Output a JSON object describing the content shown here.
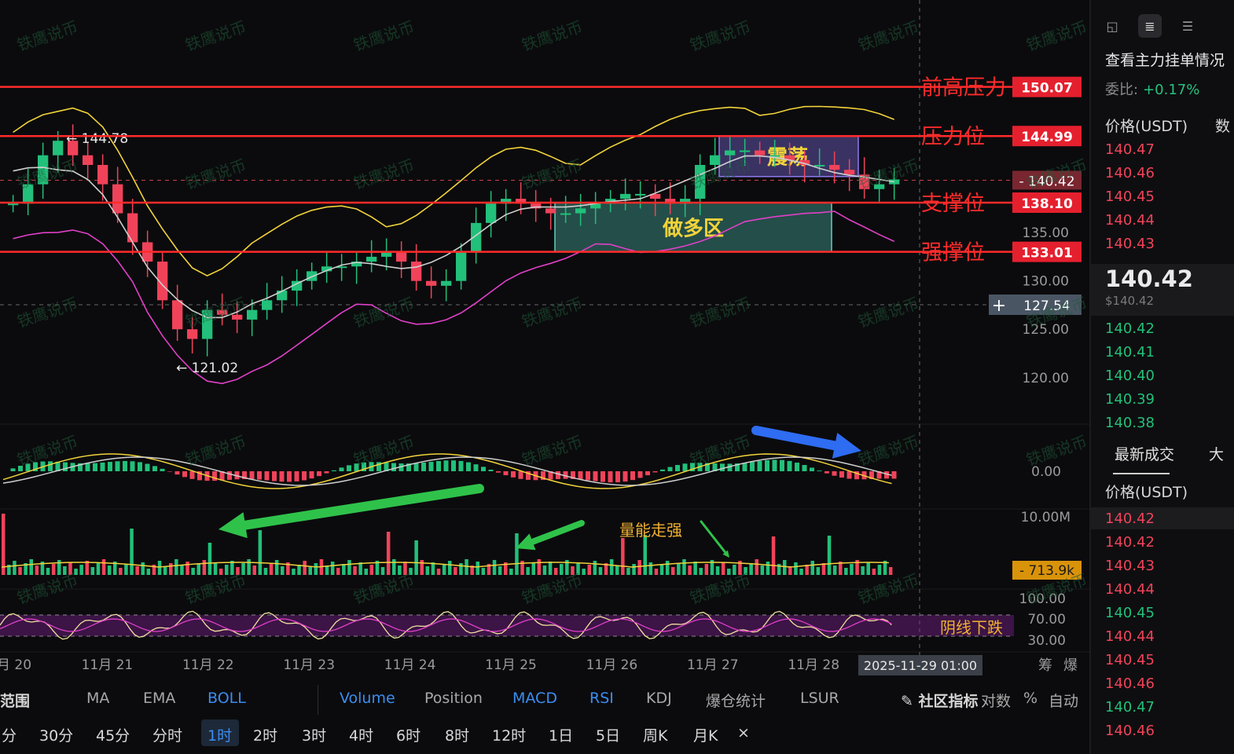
{
  "colors": {
    "up": "#22c07a",
    "down": "#f0435a",
    "boll_upper": "#f2d33a",
    "boll_mid": "#cfcfcf",
    "boll_lower": "#e040c8",
    "level_line": "#ff2b2b",
    "box_long": "#5fd0c0",
    "box_range": "#8f7bf0",
    "arrow_green": "#2fc24a",
    "arrow_blue": "#2e6cf2",
    "watermark": "#1f5a3a"
  },
  "watermark_text": "铁鹰说币",
  "chart_data": {
    "type": "candlestick",
    "timeframe": "1时",
    "x_ticks": [
      "月 20",
      "11月 21",
      "11月 22",
      "11月 23",
      "11月 24",
      "11月 25",
      "11月 26",
      "11月 27",
      "11月 28"
    ],
    "crosshair_time": "2025-11-29 01:00",
    "y_ticks": [
      "135.00",
      "130.00",
      "125.00",
      "120.00"
    ],
    "ylim": [
      116,
      155
    ],
    "price_extremes": [
      {
        "label": "← 144.78",
        "value": 144.78
      },
      {
        "label": "← 121.02",
        "value": 121.02
      }
    ],
    "close_series": [
      138,
      140,
      143,
      144.5,
      143,
      142,
      140,
      137,
      134,
      132,
      128,
      125,
      124,
      127,
      126.5,
      126,
      127,
      128,
      129,
      130,
      131,
      131.5,
      131.5,
      132,
      132.5,
      133,
      132,
      130,
      129.5,
      130,
      133,
      136,
      138,
      138.5,
      138,
      137.5,
      137,
      137,
      137.5,
      138,
      138.5,
      139,
      139,
      138.5,
      138,
      138.5,
      142,
      143,
      143.5,
      143.5,
      143,
      143,
      142.5,
      142,
      142,
      141.5,
      141,
      139.5,
      140,
      140.5
    ],
    "levels": [
      {
        "label": "前高压力",
        "value": 150.07,
        "price": "150.07"
      },
      {
        "label": "压力位",
        "value": 144.99,
        "price": "144.99"
      },
      {
        "label": "支撑位",
        "value": 138.1,
        "price": "138.10"
      },
      {
        "label": "强撑位",
        "value": 133.01,
        "price": "133.01"
      }
    ],
    "current_price": {
      "value": 140.42,
      "label": "140.42"
    },
    "crosshair_price": {
      "value": 127.54,
      "label": "127.54"
    },
    "zones": [
      {
        "label": "做多区",
        "x_start": "11月 25",
        "x_end": "11月 27",
        "y_top": 138.1,
        "y_bottom": 133.01
      },
      {
        "label": "震荡",
        "x_start": "11月 27",
        "x_end": "11月 28",
        "y_top": 144.99,
        "y_bottom": 140.8
      }
    ],
    "macd": {
      "axis_label": "0.00"
    },
    "volume": {
      "axis_label": "10.00M",
      "current": "713.9k",
      "annotation": "量能走强"
    },
    "rsi": {
      "ticks": [
        "100.00",
        "70.00",
        "30.00"
      ],
      "annotation": "阴线下跌"
    }
  },
  "right_axis_footer": [
    "筹",
    "爆"
  ],
  "side_panel": {
    "title": "查看主力挂单情况",
    "ratio_label": "委比:",
    "ratio_value": "+0.17%",
    "col_head": "价格(USDT)",
    "col_head2": "数",
    "asks": [
      "140.47",
      "140.46",
      "140.45",
      "140.44",
      "140.43"
    ],
    "last_price": "140.42",
    "last_price_usd": "$140.42",
    "bids": [
      "140.42",
      "140.41",
      "140.40",
      "140.39",
      "140.38"
    ],
    "trades_tab": "最新成交",
    "trades_tab2": "大",
    "trades_head": "价格(USDT)",
    "trades": [
      {
        "p": "140.42",
        "s": "down"
      },
      {
        "p": "140.42",
        "s": "down"
      },
      {
        "p": "140.43",
        "s": "down"
      },
      {
        "p": "140.44",
        "s": "down"
      },
      {
        "p": "140.45",
        "s": "up"
      },
      {
        "p": "140.44",
        "s": "down"
      },
      {
        "p": "140.45",
        "s": "down"
      },
      {
        "p": "140.46",
        "s": "down"
      },
      {
        "p": "140.47",
        "s": "up"
      },
      {
        "p": "140.46",
        "s": "down"
      }
    ]
  },
  "indicator_bar": [
    "范围",
    "MA",
    "EMA",
    "BOLL",
    "Volume",
    "Position",
    "MACD",
    "RSI",
    "KDJ",
    "爆仓统计",
    "LSUR",
    "社区指标",
    "对数",
    "%",
    "自动"
  ],
  "interval_bar": [
    "分",
    "30分",
    "45分",
    "分时",
    "1时",
    "2时",
    "3时",
    "4时",
    "6时",
    "8时",
    "12时",
    "1日",
    "5日",
    "周K",
    "月K",
    "×"
  ],
  "selected_interval": "1时"
}
